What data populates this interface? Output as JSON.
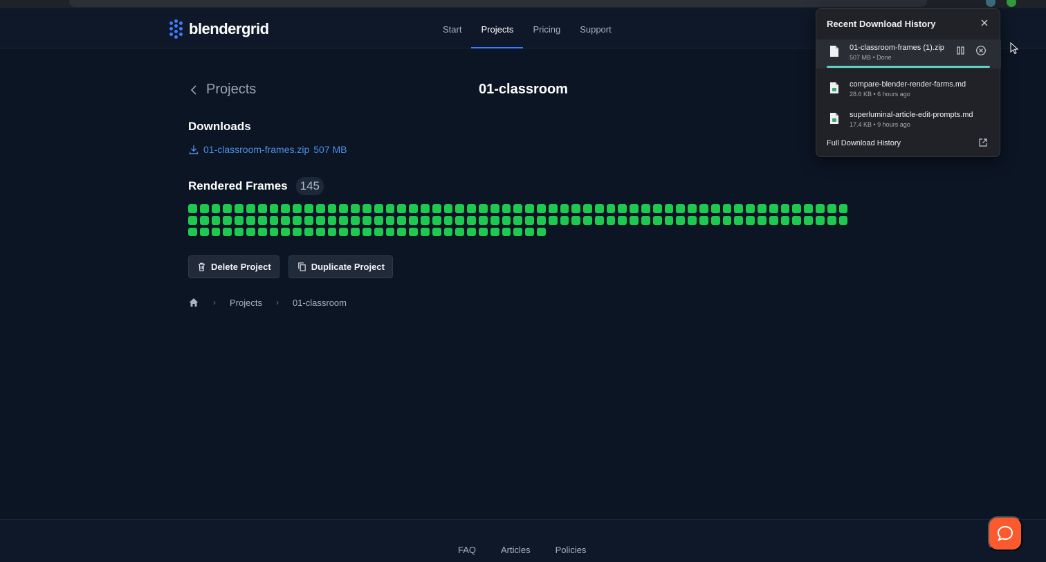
{
  "nav": {
    "logo_text": "blendergrid",
    "links": [
      "Start",
      "Projects",
      "Pricing",
      "Support"
    ],
    "active": "Projects"
  },
  "page": {
    "back_label": "Projects",
    "title": "01-classroom",
    "downloads_heading": "Downloads",
    "download_file": "01-classroom-frames.zip",
    "download_size": "507 MB",
    "frames_heading": "Rendered Frames",
    "frames_count": "145",
    "frames_total": 145,
    "frame_color": "#1ec94f",
    "delete_label": "Delete Project",
    "duplicate_label": "Duplicate Project",
    "breadcrumb": [
      "Projects",
      "01-classroom"
    ]
  },
  "footer": {
    "links": [
      "FAQ",
      "Articles",
      "Policies"
    ]
  },
  "download_panel": {
    "title": "Recent Download History",
    "items": [
      {
        "name": "01-classroom-frames (1).zip",
        "meta": "507 MB • Done",
        "active": true
      },
      {
        "name": "compare-blender-render-farms.md",
        "meta": "28.6 KB • 6 hours ago"
      },
      {
        "name": "superluminal-article-edit-prompts.md",
        "meta": "17.4 KB • 9 hours ago"
      }
    ],
    "progress": 1.0,
    "full_history_label": "Full Download History"
  },
  "colors": {
    "accent": "#3c7dff",
    "link": "#4f8fe8",
    "help": "#fb5a2e"
  }
}
